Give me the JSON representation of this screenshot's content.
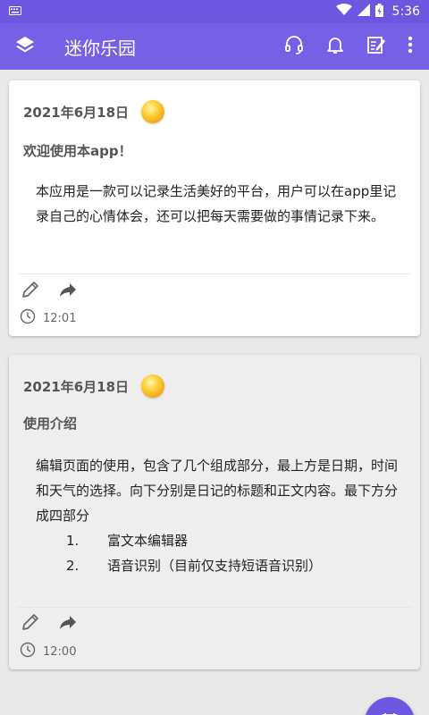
{
  "status": {
    "time": "5:36"
  },
  "appbar": {
    "title": "迷你乐园"
  },
  "notes": [
    {
      "date": "2021年6月18日",
      "title": "欢迎使用本app！",
      "body": "本应用是一款可以记录生活美好的平台，用户可以在app里记录自己的心情体会，还可以把每天需要做的事情记录下来。",
      "time": "12:01"
    },
    {
      "date": "2021年6月18日",
      "title": "使用介绍",
      "body": "编辑页面的使用，包含了几个组成部分，最上方是日期，时间和天气的选择。向下分别是日记的标题和正文内容。最下方分成四部分",
      "list": [
        {
          "num": "1.",
          "text": "富文本编辑器"
        },
        {
          "num": "2.",
          "text": "语音识别（目前仅支持短语音识别）"
        }
      ],
      "time": "12:00"
    }
  ]
}
